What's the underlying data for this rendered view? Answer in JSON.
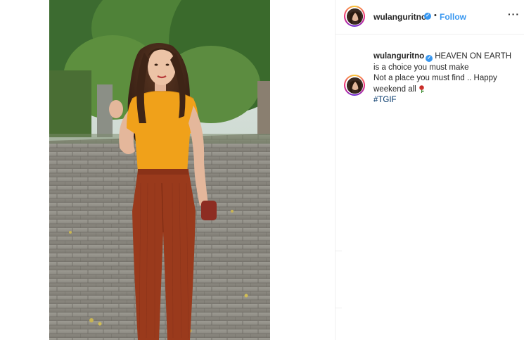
{
  "post": {
    "username": "wulanguritno",
    "follow_label": "Follow",
    "separator": "•",
    "more_label": "···"
  },
  "caption": {
    "username": "wulanguritno",
    "line1": "HEAVEN ON EARTH",
    "line2": "is a choice you must make",
    "line3": "Not a place you must find .. Happy weekend all",
    "hashtag": "#TGIF",
    "emoji": "rose-icon"
  },
  "colors": {
    "accent": "#3897f0",
    "hashtag": "#003569",
    "text": "#262626",
    "top": "#f0a11a",
    "pants": "#9a3a1c"
  }
}
